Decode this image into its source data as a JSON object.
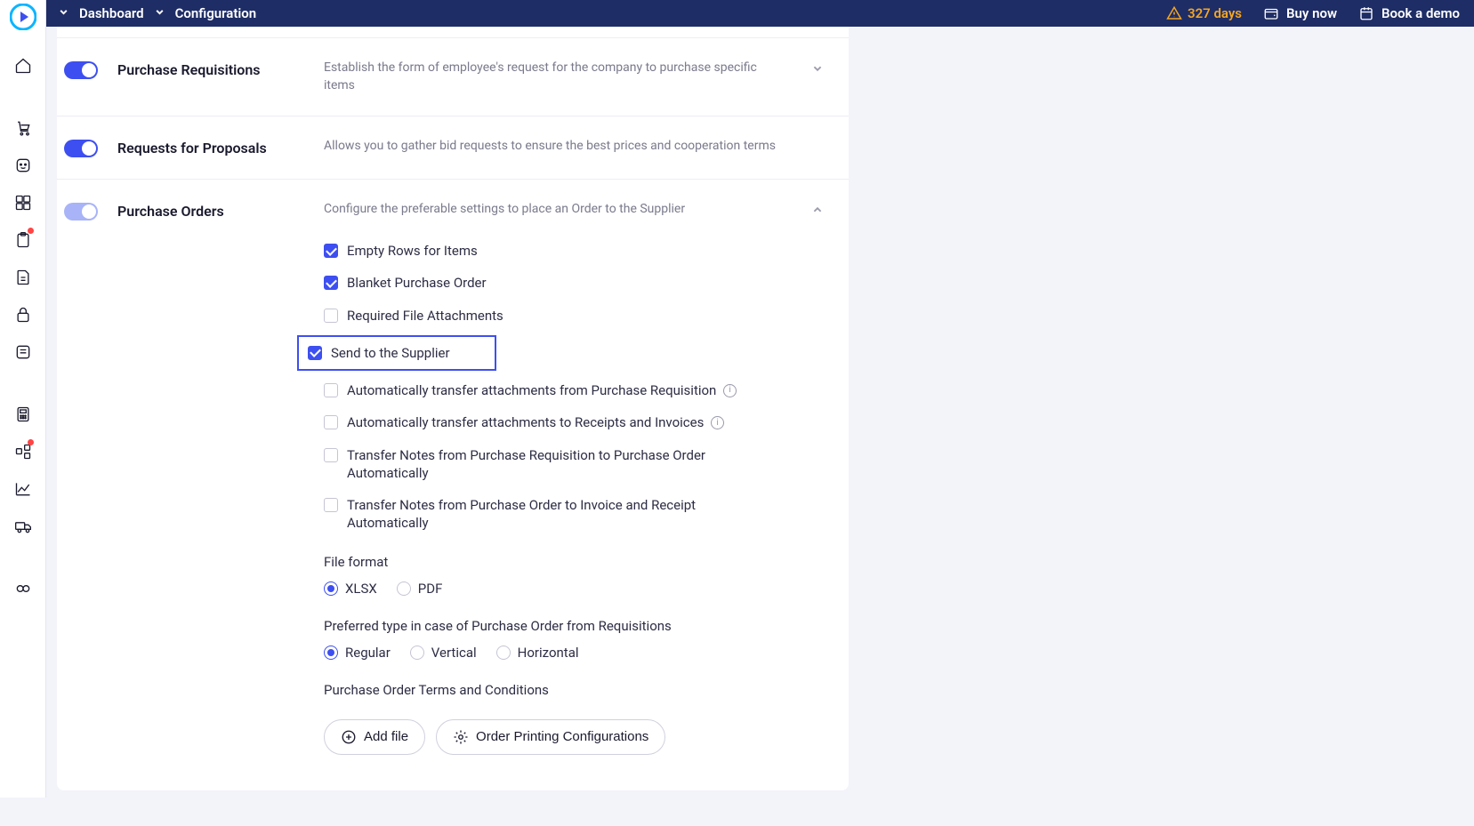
{
  "header": {
    "breadcrumb1": "Dashboard",
    "breadcrumb2": "Configuration",
    "days": "327 days",
    "buy": "Buy now",
    "demo": "Book a demo"
  },
  "sections": {
    "requisitions": {
      "title": "Purchase Requisitions",
      "desc": "Establish the form of employee's request for the company to purchase specific items"
    },
    "rfp": {
      "title": "Requests for Proposals",
      "desc": "Allows you to gather bid requests to ensure the best prices and cooperation terms"
    },
    "po": {
      "title": "Purchase Orders",
      "desc": "Configure the preferable settings to place an Order to the Supplier"
    }
  },
  "po_options": {
    "empty_rows": "Empty Rows for Items",
    "blanket": "Blanket Purchase Order",
    "required_files": "Required File Attachments",
    "send_supplier": "Send to the Supplier",
    "auto_transfer_pr": "Automatically transfer attachments from Purchase Requisition",
    "auto_transfer_ri": "Automatically transfer attachments to Receipts and Invoices",
    "transfer_notes_pr": "Transfer Notes from Purchase Requisition to Purchase Order Automatically",
    "transfer_notes_ir": "Transfer Notes from Purchase Order to Invoice and Receipt Automatically"
  },
  "file_format": {
    "title": "File format",
    "xlsx": "XLSX",
    "pdf": "PDF"
  },
  "preferred_type": {
    "title": "Preferred type in case of Purchase Order from Requisitions",
    "regular": "Regular",
    "vertical": "Vertical",
    "horizontal": "Horizontal"
  },
  "terms": {
    "title": "Purchase Order Terms and Conditions"
  },
  "buttons": {
    "add_file": "Add file",
    "print_config": "Order Printing Configurations"
  }
}
